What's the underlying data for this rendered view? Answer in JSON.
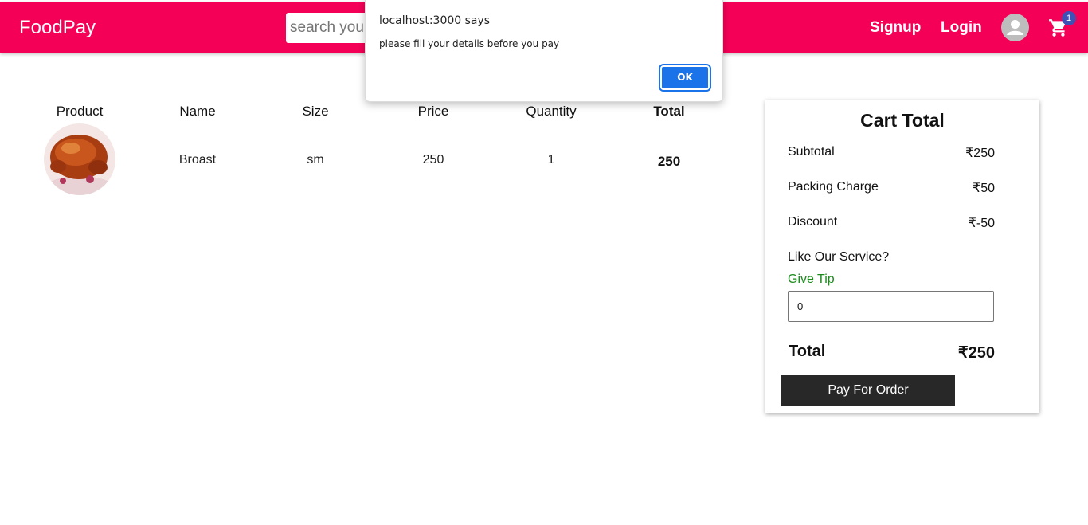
{
  "app": {
    "brand": "FoodPay"
  },
  "header": {
    "search_placeholder": "search your",
    "signup_label": "Signup",
    "login_label": "Login",
    "avatar_icon": "account-circle-icon",
    "cart_icon": "shopping-cart-icon",
    "cart_count": "1",
    "brand_color": "#f50057"
  },
  "table": {
    "headers": [
      "Product",
      "Name",
      "Size",
      "Price",
      "Quantity",
      "Total"
    ],
    "rows": [
      {
        "image": "roast-chicken-image",
        "name": "Broast",
        "size": "sm",
        "price": "250",
        "quantity": "1",
        "total": "250"
      }
    ]
  },
  "cart": {
    "title": "Cart Total",
    "subtotal_label": "Subtotal",
    "subtotal_value": "₹250",
    "packing_label": "Packing Charge",
    "packing_value": "₹50",
    "discount_label": "Discount",
    "discount_value": "₹-50",
    "like_text": "Like Our Service?",
    "tip_label": "Give Tip",
    "tip_value": "0",
    "total_label": "Total",
    "total_value": "₹250",
    "pay_label": "Pay For Order"
  },
  "dialog": {
    "title": "localhost:3000 says",
    "message": "please fill your details before you pay",
    "ok_label": "OK",
    "accent": "#1a73e8"
  }
}
